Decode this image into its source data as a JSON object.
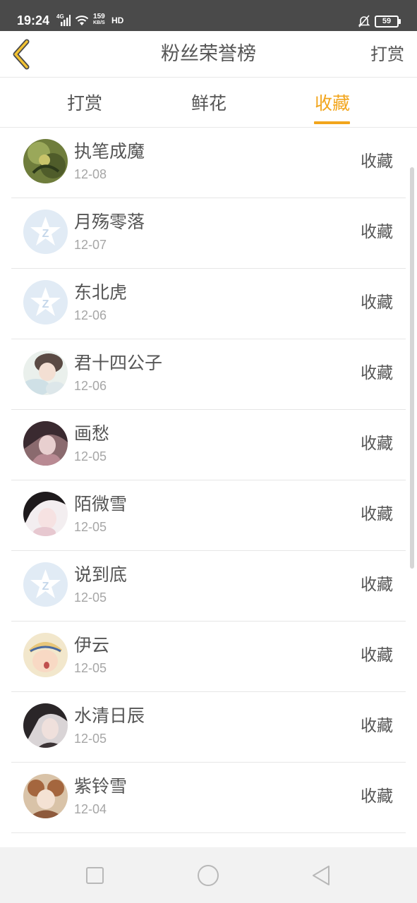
{
  "status_bar": {
    "time": "19:24",
    "network": "4G",
    "speed_value": "159",
    "speed_unit": "KB/S",
    "hd": "HD",
    "battery": "59",
    "icons": [
      "signal-icon",
      "wifi-icon",
      "mute-icon",
      "battery-icon"
    ]
  },
  "header": {
    "title": "粉丝荣誉榜",
    "action": "打赏",
    "back_icon": "chevron-left-icon"
  },
  "tabs": [
    {
      "label": "打赏",
      "active": false
    },
    {
      "label": "鲜花",
      "active": false
    },
    {
      "label": "收藏",
      "active": true
    }
  ],
  "colors": {
    "accent": "#f2a51c",
    "text": "#555555",
    "subtext": "#a6a6a6",
    "divider": "#e6e6e6"
  },
  "list": [
    {
      "name": "执笔成魔",
      "date": "12-08",
      "action": "收藏",
      "avatar": "photo-green"
    },
    {
      "name": "月殇零落",
      "date": "12-07",
      "action": "收藏",
      "avatar": "default-star"
    },
    {
      "name": "东北虎",
      "date": "12-06",
      "action": "收藏",
      "avatar": "default-star"
    },
    {
      "name": "君十四公子",
      "date": "12-06",
      "action": "收藏",
      "avatar": "photo-light"
    },
    {
      "name": "画愁",
      "date": "12-05",
      "action": "收藏",
      "avatar": "photo-dark"
    },
    {
      "name": "陌微雪",
      "date": "12-05",
      "action": "收藏",
      "avatar": "photo-girl"
    },
    {
      "name": "说到底",
      "date": "12-05",
      "action": "收藏",
      "avatar": "default-star"
    },
    {
      "name": "伊云",
      "date": "12-05",
      "action": "收藏",
      "avatar": "photo-baby"
    },
    {
      "name": "水清日辰",
      "date": "12-05",
      "action": "收藏",
      "avatar": "photo-man"
    },
    {
      "name": "紫铃雪",
      "date": "12-04",
      "action": "收藏",
      "avatar": "photo-vintage"
    }
  ],
  "nav_bar": {
    "buttons": [
      "recents-square-icon",
      "home-circle-icon",
      "back-triangle-icon"
    ]
  }
}
